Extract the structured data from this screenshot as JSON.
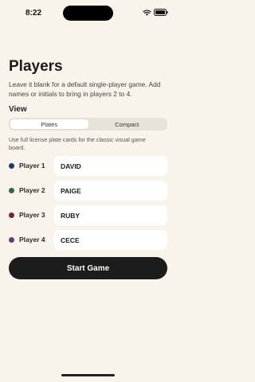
{
  "status_bar": {
    "time": "8:22"
  },
  "page": {
    "title": "Players",
    "intro": "Leave it blank for a default single-player game. Add names or initials to bring in players 2 to 4."
  },
  "view": {
    "label": "View",
    "options": [
      "Plates",
      "Compact"
    ],
    "selected": "Plates",
    "hint": "Use full license plate cards for the classic visual game board."
  },
  "players": [
    {
      "label": "Player 1",
      "value": "DAVID",
      "color": "#1f3a6e"
    },
    {
      "label": "Player 2",
      "value": "PAIGE",
      "color": "#2e6a3d"
    },
    {
      "label": "Player 3",
      "value": "RUBY",
      "color": "#7a2332"
    },
    {
      "label": "Player 4",
      "value": "CECE",
      "color": "#6b3a72"
    }
  ],
  "actions": {
    "start_label": "Start Game"
  },
  "colors": {
    "background": "#f8f4ec",
    "button": "#1c1c1c",
    "field": "#ffffff"
  }
}
